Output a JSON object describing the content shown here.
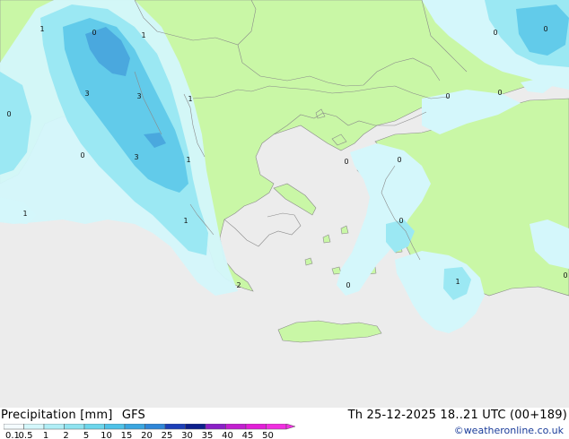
{
  "legend": {
    "title": "Precipitation [mm]",
    "model": "GFS",
    "datetime": "Th 25-12-2025 18..21 UTC (00+189)",
    "credit": "©weatheronline.co.uk",
    "ticks": [
      "0.1",
      "0.5",
      "1",
      "2",
      "5",
      "10",
      "15",
      "20",
      "25",
      "30",
      "35",
      "40",
      "45",
      "50"
    ],
    "colors": [
      "#f4fbff",
      "#d4f7fb",
      "#b0eef6",
      "#8fe3f0",
      "#6dd6ec",
      "#4fc2e8",
      "#3aa6e0",
      "#2f86d8",
      "#1c3fb8",
      "#0d1f8c",
      "#8a1fc6",
      "#c21fd0",
      "#e21fd8",
      "#f02fe0"
    ]
  },
  "map": {
    "colors": {
      "sea": "#ececec",
      "land": "#c9f7a6",
      "precip_light": "#d4f7fb",
      "precip_mid": "#9be8f3",
      "precip_heavy": "#62cbea",
      "precip_core": "#4aa8de",
      "border": "#8a8a8a"
    },
    "values": [
      {
        "label": "1"
      },
      {
        "label": "0"
      },
      {
        "label": "1"
      },
      {
        "label": "3"
      },
      {
        "label": "3"
      },
      {
        "label": "1"
      },
      {
        "label": "0"
      },
      {
        "label": "3"
      },
      {
        "label": "1"
      },
      {
        "label": "1"
      },
      {
        "label": "1"
      },
      {
        "label": "0"
      },
      {
        "label": "0"
      },
      {
        "label": "0"
      },
      {
        "label": "0"
      },
      {
        "label": "0"
      },
      {
        "label": "0"
      },
      {
        "label": "1"
      },
      {
        "label": "0"
      },
      {
        "label": "2"
      },
      {
        "label": "0"
      },
      {
        "label": "0"
      },
      {
        "label": "0"
      }
    ]
  }
}
